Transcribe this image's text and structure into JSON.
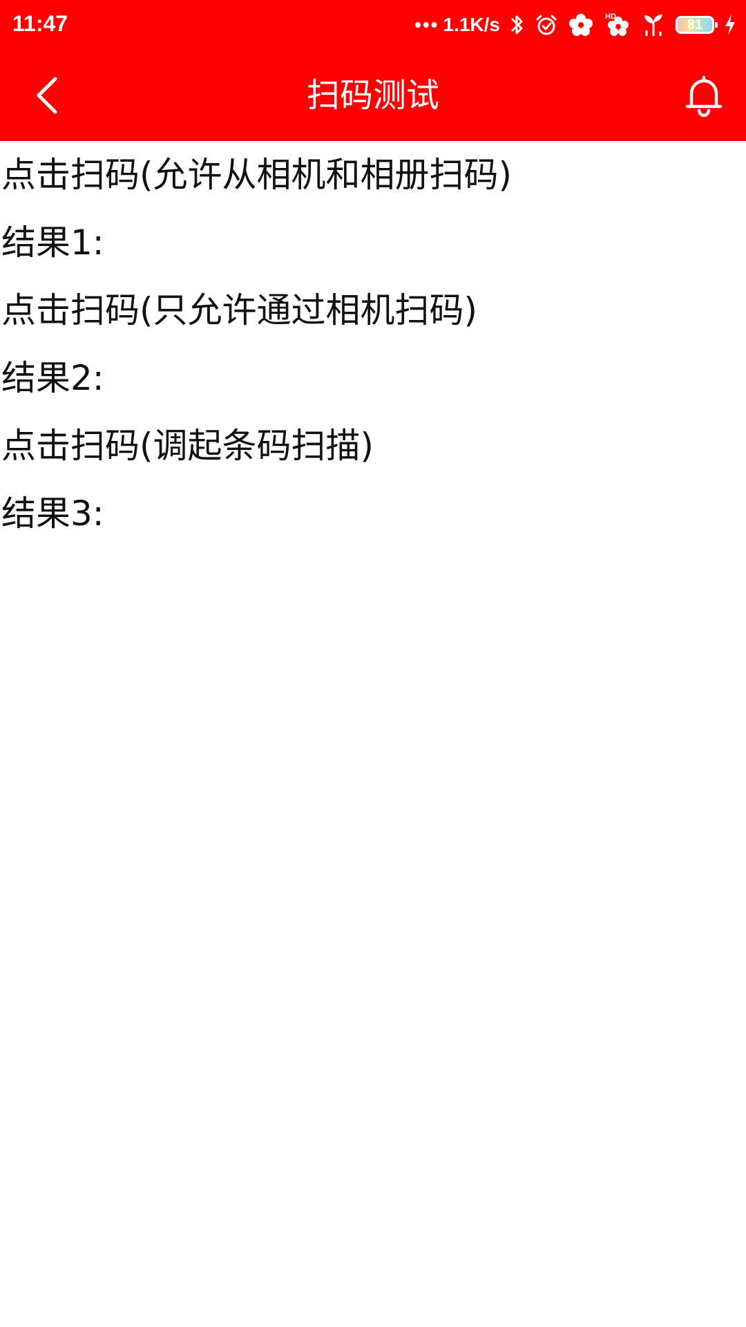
{
  "status_bar": {
    "time": "11:47",
    "network_speed": "1.1K/s",
    "battery_level": "81",
    "icons": [
      "bluetooth-icon",
      "alarm-icon",
      "flower-icon",
      "hd-flower-icon",
      "sprout-icon",
      "battery-icon",
      "charging-icon"
    ]
  },
  "app_bar": {
    "title": "扫码测试",
    "back_icon": "chevron-left-icon",
    "bell_icon": "bell-icon"
  },
  "content": {
    "rows": [
      {
        "type": "action",
        "text": "点击扫码(允许从相机和相册扫码)"
      },
      {
        "type": "result",
        "text": "结果1:"
      },
      {
        "type": "action",
        "text": "点击扫码(只允许通过相机扫码)"
      },
      {
        "type": "result",
        "text": "结果2:"
      },
      {
        "type": "action",
        "text": "点击扫码(调起条码扫描)"
      },
      {
        "type": "result",
        "text": "结果3:"
      }
    ]
  },
  "colors": {
    "brand": "#ff0000",
    "on_brand": "#ffffff",
    "text": "#111111",
    "background": "#ffffff"
  }
}
